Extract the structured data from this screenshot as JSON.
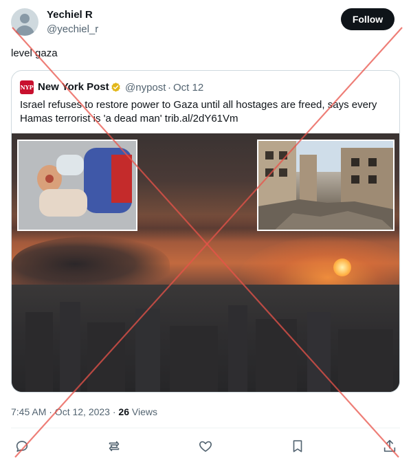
{
  "author": {
    "display_name": "Yechiel R",
    "handle": "@yechiel_r",
    "follow_label": "Follow"
  },
  "tweet": {
    "text": "level gaza"
  },
  "quoted_tweet": {
    "avatar_text": "NYP",
    "name": "New York Post",
    "verified": true,
    "verified_color": "#e2b719",
    "handle": "@nypost",
    "separator": "·",
    "date": "Oct 12",
    "text": "Israel refuses to restore power to Gaza until all hostages are freed, says every Hamas terrorist is 'a dead man' trib.al/2dY61Vm"
  },
  "meta": {
    "time": "7:45 AM · Oct 12, 2023 · ",
    "views_count": "26",
    "views_label": " Views"
  },
  "actions": {
    "reply_icon": "reply-icon",
    "retweet_icon": "retweet-icon",
    "like_icon": "heart-icon",
    "bookmark_icon": "bookmark-icon",
    "share_icon": "share-icon"
  },
  "colors": {
    "text_primary": "#0f1419",
    "text_secondary": "#536471",
    "border": "#cfd9de",
    "overlay_x": "#e8534a"
  }
}
